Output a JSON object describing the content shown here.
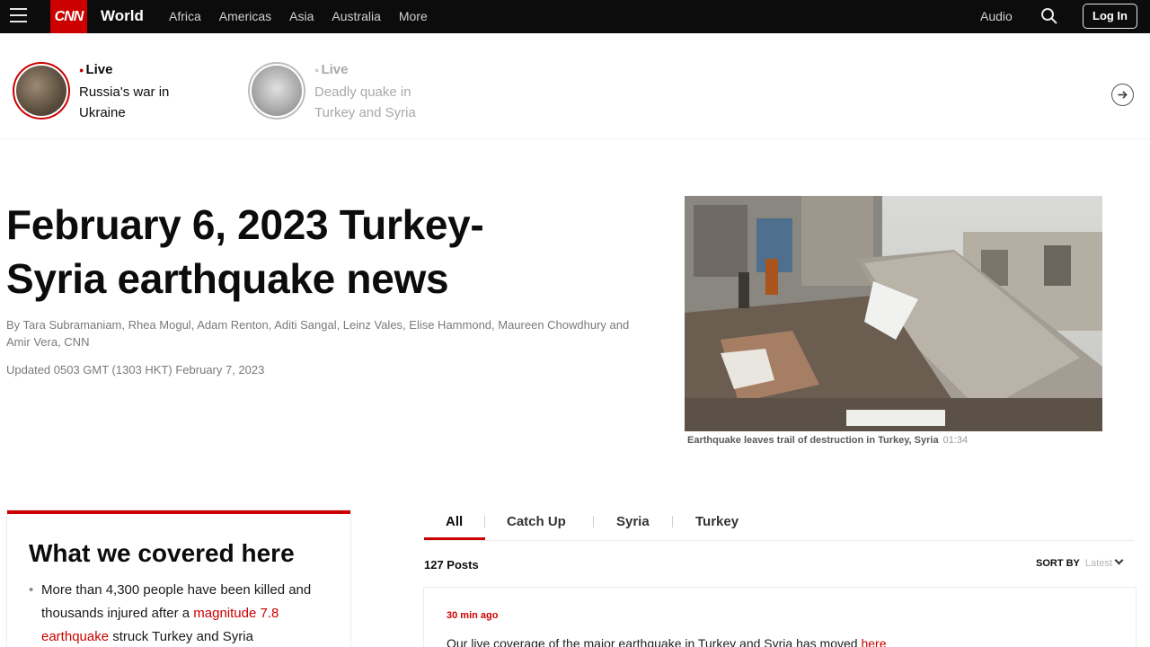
{
  "nav": {
    "logo": "CNN",
    "section": "World",
    "links": [
      "Africa",
      "Americas",
      "Asia",
      "Australia",
      "More"
    ],
    "audio": "Audio",
    "login": "Log In",
    "icons": {
      "menu": "hamburger-icon",
      "search": "search-icon"
    }
  },
  "live_strip": {
    "items": [
      {
        "label": "Live",
        "title": "Russia's war in Ukraine"
      },
      {
        "label": "Live",
        "title": "Deadly quake in Turkey and Syria"
      }
    ],
    "arrow_icon": "arrow-right-circle-icon"
  },
  "article": {
    "headline": "February 6, 2023 Turkey-Syria earthquake news",
    "byline": "By Tara Subramaniam, Rhea Mogul, Adam Renton, Aditi Sangal, Leinz Vales, Elise Hammond, Maureen Chowdhury and Amir Vera, CNN",
    "updated": "Updated 0503 GMT (1303 HKT) February 7, 2023"
  },
  "hero": {
    "caption": "Earthquake leaves trail of destruction in Turkey, Syria",
    "duration": "01:34"
  },
  "covered": {
    "title": "What we covered here",
    "bullet_before": "More than 4,300 people have been killed and thousands injured after a ",
    "bullet_link": "magnitude 7.8 earthquake",
    "bullet_after": " struck Turkey and Syria"
  },
  "feed": {
    "tabs": [
      "All",
      "Catch Up",
      "Syria",
      "Turkey"
    ],
    "active_tab": "All",
    "posts_count": "127 Posts",
    "sort_label": "SORT BY",
    "sort_value": "Latest",
    "post": {
      "time": "30 min ago",
      "text": "Our live coverage of the major earthquake in Turkey and Syria has moved ",
      "link": "here"
    }
  },
  "colors": {
    "brand": "#cc0000",
    "nav_bg": "#0c0c0c"
  }
}
